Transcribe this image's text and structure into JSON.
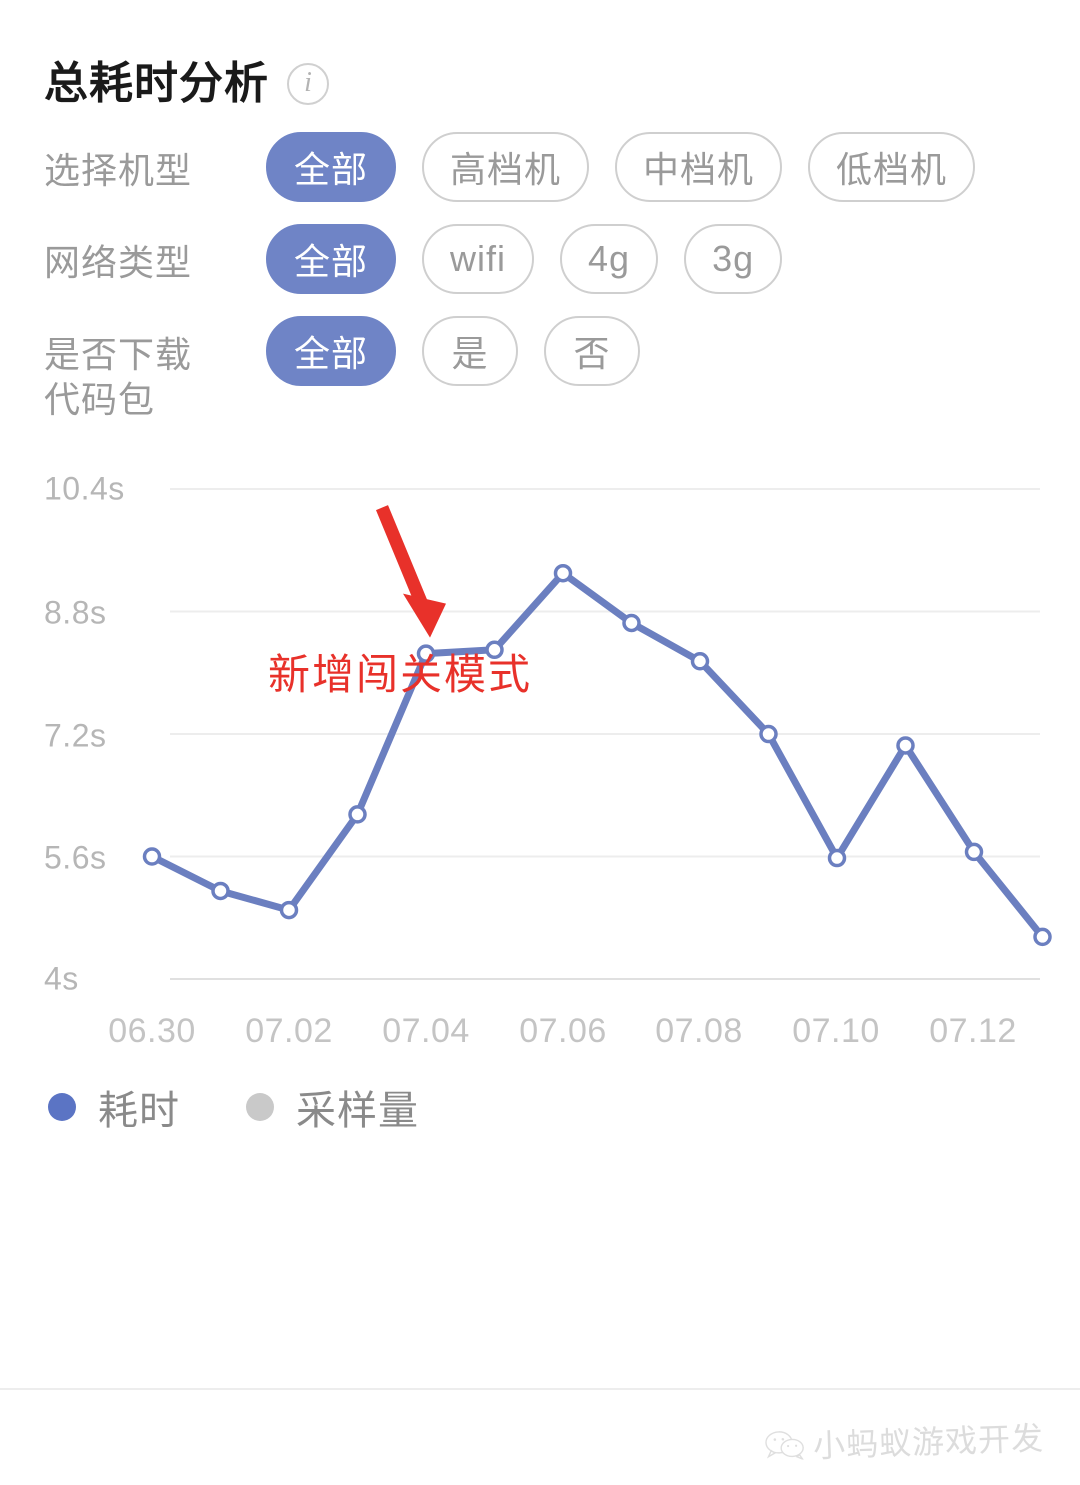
{
  "header": {
    "title": "总耗时分析",
    "info_icon": "info-icon",
    "info_glyph": "i"
  },
  "filters": [
    {
      "label": "选择机型",
      "label_line2": "",
      "options": [
        "全部",
        "高档机",
        "中档机",
        "低档机"
      ],
      "selected": "全部"
    },
    {
      "label": "网络类型",
      "label_line2": "",
      "options": [
        "全部",
        "wifi",
        "4g",
        "3g"
      ],
      "selected": "全部"
    },
    {
      "label": "是否下载",
      "label_line2": "代码包",
      "options": [
        "全部",
        "是",
        "否"
      ],
      "selected": "全部"
    }
  ],
  "legend": [
    {
      "label": "耗时",
      "color": "#5b74c4"
    },
    {
      "label": "采样量",
      "color": "#c9c9c9"
    }
  ],
  "colors": {
    "accent": "#6f84c6",
    "line": "#6b7fc0",
    "annotation": "#e8312a",
    "grid": "#ededed",
    "axis_text": "#c4c4c4"
  },
  "watermark": {
    "text": "小蚂蚁游戏开发",
    "icon": "wechat-icon"
  },
  "chart_data": {
    "type": "line",
    "title": "总耗时分析",
    "xlabel": "",
    "ylabel": "耗时",
    "grid": true,
    "legend_position": "bottom-left",
    "ylim": [
      4,
      10.4
    ],
    "ytick_labels": [
      "10.4s",
      "8.8s",
      "7.2s",
      "5.6s",
      "4s"
    ],
    "ytick_values": [
      10.4,
      8.8,
      7.2,
      5.6,
      4
    ],
    "xtick_labels": [
      "06.30",
      "07.02",
      "07.04",
      "07.06",
      "07.08",
      "07.10",
      "07.12"
    ],
    "x": [
      "06.30",
      "07.01",
      "07.02",
      "07.03",
      "07.04",
      "07.05",
      "07.06",
      "07.07",
      "07.08",
      "07.09",
      "07.10",
      "07.11",
      "07.12",
      "07.13"
    ],
    "series": [
      {
        "name": "耗时",
        "unit": "s",
        "color": "#6b7fc0",
        "values": [
          5.6,
          5.15,
          4.9,
          6.15,
          8.25,
          8.3,
          9.3,
          8.65,
          8.15,
          7.2,
          5.58,
          7.05,
          5.66,
          4.55
        ]
      },
      {
        "name": "采样量",
        "unit": "",
        "color": "#c9c9c9",
        "values": []
      }
    ],
    "annotations": [
      {
        "text": "新增闯关模式",
        "color": "#e8312a",
        "points_to_x": "07.04",
        "points_to_y": 8.25
      }
    ]
  }
}
